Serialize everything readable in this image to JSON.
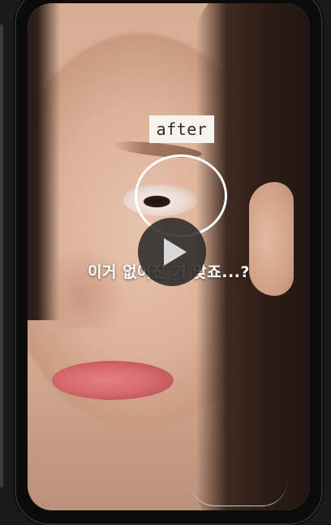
{
  "video": {
    "overlay_label": "after",
    "caption": "이거 없어진 거 맞죠...?",
    "state": "paused"
  },
  "colors": {
    "frame": "#0b0b0b",
    "background": "#1a1a1a",
    "label_bg": "#f7f3ee",
    "play_button_bg": "#1e1e1e",
    "caption_text": "#ffffff"
  },
  "icons": {
    "play": "play-icon"
  }
}
